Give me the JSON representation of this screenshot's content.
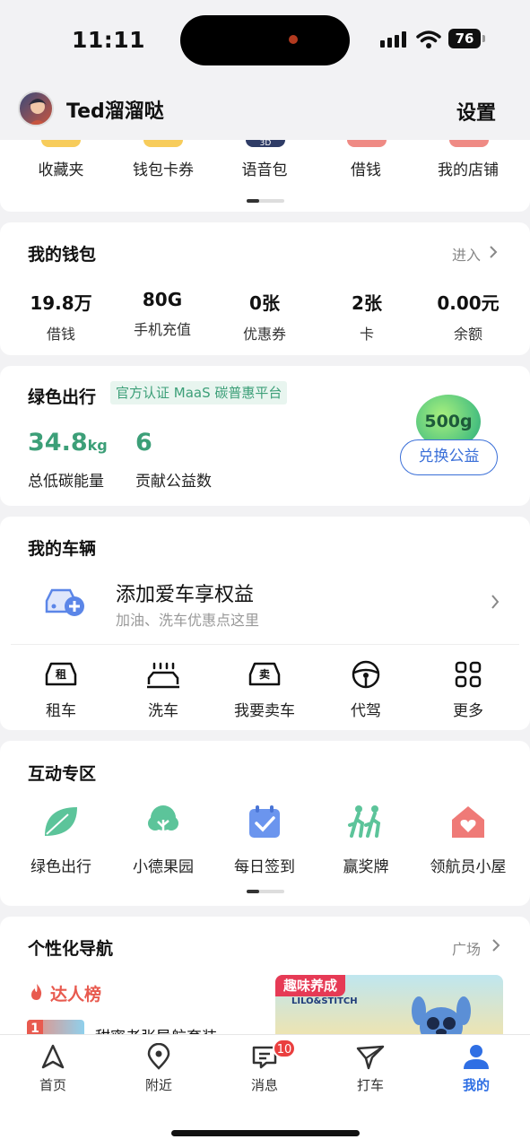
{
  "status": {
    "time": "11:11",
    "battery": "76"
  },
  "header": {
    "username": "Ted溜溜哒",
    "settings": "设置"
  },
  "shortcuts": [
    {
      "label": "收藏夹",
      "color": "#f7cc5b"
    },
    {
      "label": "钱包卡券",
      "color": "#f7cc5b"
    },
    {
      "label": "语音包",
      "color": "#2f3c66",
      "tag": "3D"
    },
    {
      "label": "借钱",
      "color": "#ef8a84"
    },
    {
      "label": "我的店铺",
      "color": "#ef8a84"
    }
  ],
  "wallet": {
    "title": "我的钱包",
    "enter": "进入",
    "items": [
      {
        "value": "19.8万",
        "label": "借钱"
      },
      {
        "value": "80G",
        "label": "手机充值"
      },
      {
        "value": "0张",
        "label": "优惠券"
      },
      {
        "value": "2张",
        "label": "卡"
      },
      {
        "value": "0.00元",
        "label": "余额"
      }
    ]
  },
  "green": {
    "title": "绿色出行",
    "tag": "官方认证 MaaS 碳普惠平台",
    "carbon_value": "34.8",
    "carbon_unit": "kg",
    "carbon_label": "总低碳能量",
    "welfare_value": "6",
    "welfare_label": "贡献公益数",
    "badge": "500g",
    "exchange": "兑换公益"
  },
  "vehicle": {
    "title": "我的车辆",
    "add_title": "添加爱车享权益",
    "add_sub": "加油、洗车优惠点这里",
    "items": [
      {
        "label": "租车",
        "glyph": "租"
      },
      {
        "label": "洗车"
      },
      {
        "label": "我要卖车",
        "glyph": "卖"
      },
      {
        "label": "代驾"
      },
      {
        "label": "更多"
      }
    ]
  },
  "interact": {
    "title": "互动专区",
    "items": [
      {
        "label": "绿色出行"
      },
      {
        "label": "小德果园"
      },
      {
        "label": "每日签到"
      },
      {
        "label": "赢奖牌"
      },
      {
        "label": "领航员小屋"
      }
    ]
  },
  "nav": {
    "title": "个性化导航",
    "more": "广场",
    "ranking": "达人榜",
    "rank_item": "甜蜜老张导航套装",
    "rank_no": "1",
    "promo_tag": "趣味养成",
    "promo_brand": "LILO&STITCH"
  },
  "tabs": [
    {
      "label": "首页"
    },
    {
      "label": "附近"
    },
    {
      "label": "消息",
      "badge": "10"
    },
    {
      "label": "打车"
    },
    {
      "label": "我的"
    }
  ],
  "colors": {
    "accent": "#2f6fe4",
    "green": "#3c9f78",
    "red": "#ea3f3f"
  }
}
